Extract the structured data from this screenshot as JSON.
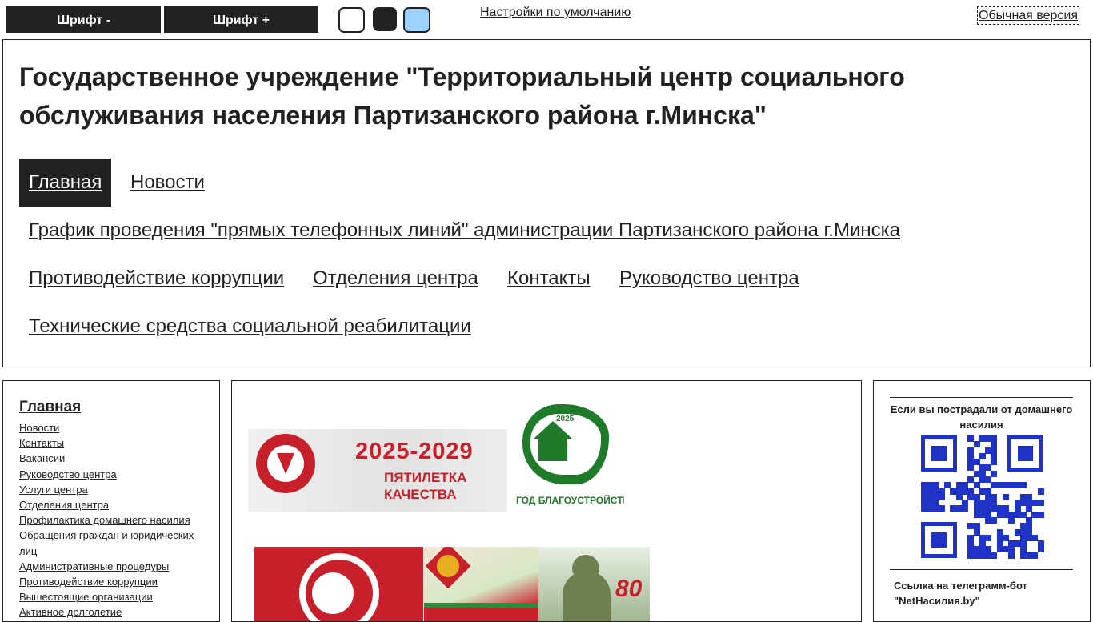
{
  "toolbar": {
    "font_decrease": "Шрифт -",
    "font_increase": "Шрифт +",
    "themes": [
      "white",
      "black",
      "blue"
    ],
    "theme_colors": {
      "white": "#ffffff",
      "black": "#222222",
      "blue": "#9dd1ff"
    },
    "defaults_link": "Настройки по умолчанию",
    "normal_version": "Обычная версия"
  },
  "header": {
    "title": "Государственное учреждение \"Территориальный центр социального обслуживания населения Партизанского района г.Минска\""
  },
  "nav": {
    "items": [
      {
        "label": "Главная",
        "active": true
      },
      {
        "label": "Новости",
        "active": false
      },
      {
        "label": "График проведения \"прямых телефонных линий\" администрации Партизанского района г.Минска",
        "active": false
      },
      {
        "label": "Противодействие коррупции",
        "active": false
      },
      {
        "label": "Отделения центра",
        "active": false
      },
      {
        "label": "Контакты",
        "active": false
      },
      {
        "label": "Руководство центра",
        "active": false
      },
      {
        "label": "Технические средства социальной реабилитации",
        "active": false
      }
    ]
  },
  "sidebar": {
    "heading": "Главная",
    "items": [
      "Новости",
      "Контакты",
      "Вакансии",
      "Руководство центра",
      "Услуги центра",
      "Отделения центра",
      "Профилактика домашнего насилия",
      "Обращения граждан и юридических лиц",
      "Административные процедуры",
      "Противодействие коррупции",
      "Вышестоящие организации",
      "Активное долголетие"
    ]
  },
  "banners": {
    "quality": {
      "years": "2025-2029",
      "line1": "ПЯТИЛЕТКА",
      "line2": "КАЧЕСТВА"
    },
    "improvement": {
      "year": "2025",
      "caption": "ГОД БЛАГОУСТРОЙСТВА"
    },
    "victory": {
      "number": "80"
    },
    "colors": {
      "red": "#c8202a",
      "green": "#1f7a2a"
    }
  },
  "right": {
    "violence_text": "Если вы пострадали от домашнего насилия",
    "qr_color": "#1f33c7",
    "bot_text": "Ссылка на телеграмм-бот \"NetНасилия.by\""
  }
}
